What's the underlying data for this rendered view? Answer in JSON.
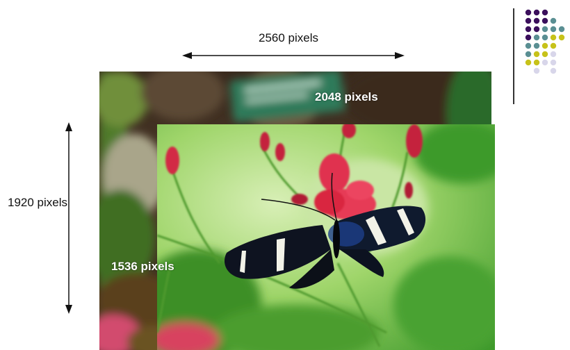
{
  "dimensions": {
    "large_width_label": "2560 pixels",
    "large_height_label": "1920 pixels",
    "small_width_label": "2048 pixels",
    "small_height_label": "1536 pixels"
  },
  "images": {
    "large": {
      "subject": "blurred garden scene with sign",
      "blur": "heavy"
    },
    "small": {
      "subject": "black and white butterfly on red flower",
      "blur": "none"
    }
  },
  "logo": {
    "colors": [
      "#3b0f5c",
      "#5a8f93",
      "#c7c21a",
      "#d8d6ea"
    ]
  }
}
